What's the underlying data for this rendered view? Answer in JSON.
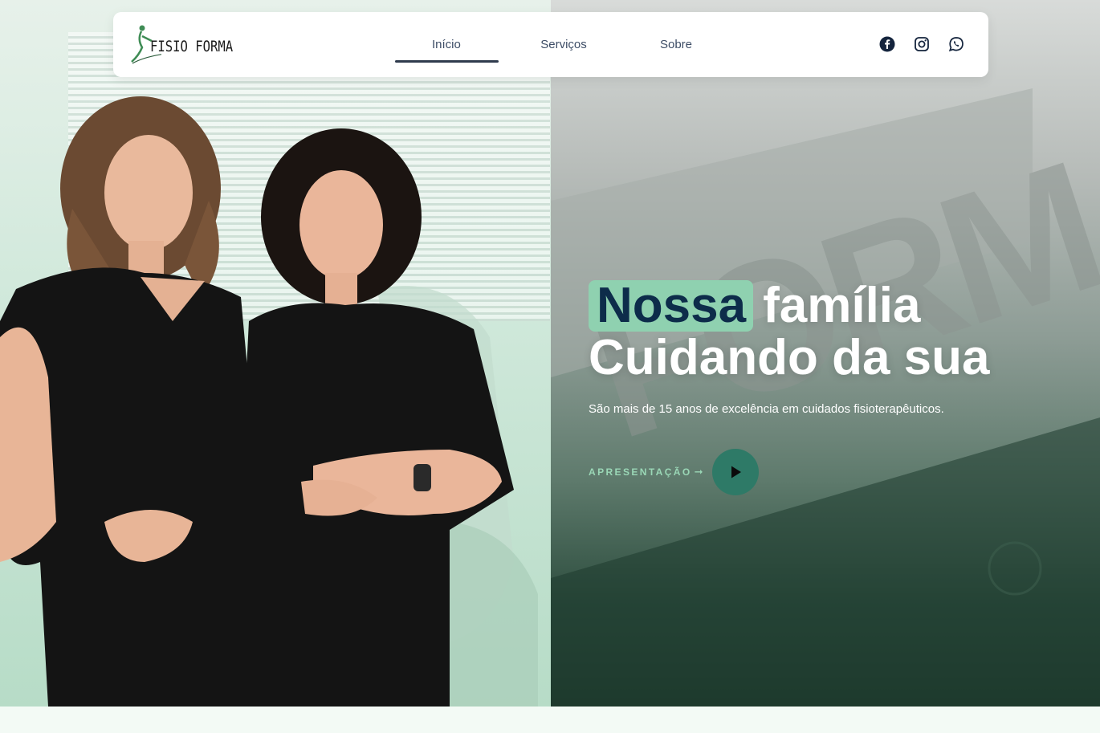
{
  "brand": {
    "name": "FISIO FORMA"
  },
  "nav": {
    "links": [
      {
        "label": "Início",
        "active": true
      },
      {
        "label": "Serviços",
        "active": false
      },
      {
        "label": "Sobre",
        "active": false
      }
    ],
    "social": [
      "facebook-icon",
      "instagram-icon",
      "whatsapp-icon"
    ]
  },
  "hero": {
    "headline_highlight": "Nossa",
    "headline_rest": "família",
    "headline_line2": "Cuidando da sua",
    "subtitle": "São mais de 15 anos de excelência em cuidados fisioterapêuticos.",
    "presentation_label": "APRESENTAÇÃO",
    "building_sign": "FORMA"
  },
  "colors": {
    "accent": "#8fd1b0",
    "headline_highlight_text": "#0d2c4a",
    "play_button": "#2e7a67",
    "nav_text": "#3d4d66"
  }
}
